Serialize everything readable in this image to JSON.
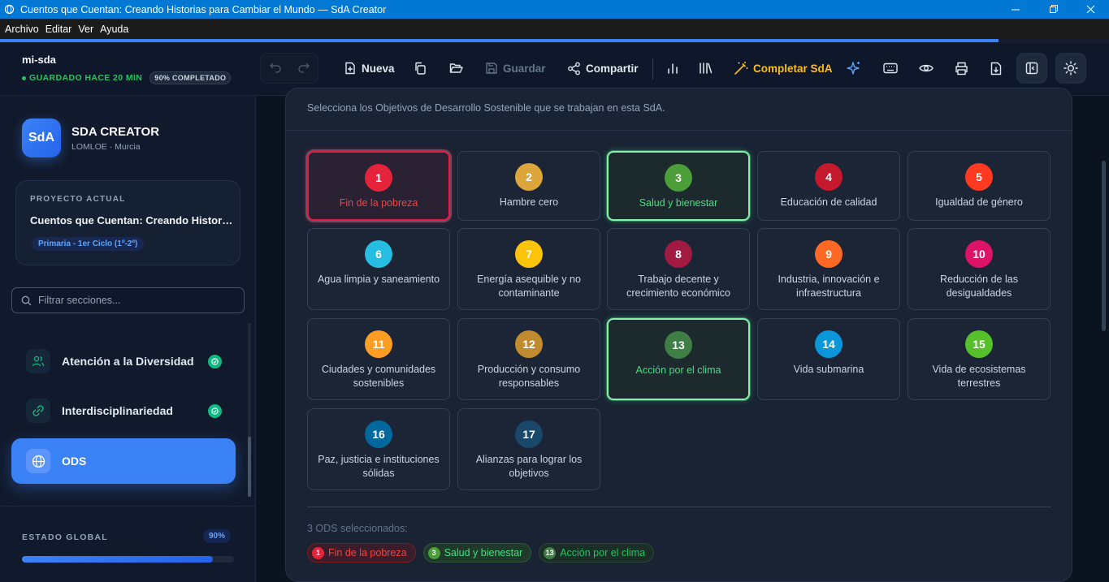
{
  "window": {
    "title": "Cuentos que Cuentan: Creando Historias para Cambiar el Mundo  — SdA Creator"
  },
  "menu": [
    "Archivo",
    "Editar",
    "Ver",
    "Ayuda"
  ],
  "header": {
    "project_slug": "mi-sda",
    "saved_status": "GUARDADO HACE 20 MIN",
    "completion_badge": "90% COMPLETADO",
    "completion_progress": 0.9
  },
  "toolbar": {
    "new_label": "Nueva",
    "save_label": "Guardar",
    "share_label": "Compartir",
    "complete_label": "Completar SdA"
  },
  "sidebar": {
    "brand_title": "SDA CREATOR",
    "brand_subtitle": "LOMLOE · Murcia",
    "logo_text": "SdA",
    "project_card": {
      "label": "PROYECTO ACTUAL",
      "title": "Cuentos que Cuentan: Creando Historias para Cambiar el Mundo",
      "level": "Primaria - 1er Ciclo (1º-2º)"
    },
    "filter_placeholder": "Filtrar secciones...",
    "items": [
      {
        "label": "Atención a la Diversidad",
        "done": true
      },
      {
        "label": "Interdisciplinariedad",
        "done": true
      },
      {
        "label": "ODS",
        "active": true
      }
    ],
    "global_label": "ESTADO GLOBAL",
    "global_percent": "90%",
    "global_progress": 0.9
  },
  "ods_panel": {
    "description": "Selecciona los Objetivos de Desarrollo Sostenible que se trabajan en esta SdA.",
    "goals": [
      {
        "n": "1",
        "name": "Fin de la pobreza",
        "color": "#e5243b",
        "selected": true
      },
      {
        "n": "2",
        "name": "Hambre cero",
        "color": "#dda63a",
        "selected": false
      },
      {
        "n": "3",
        "name": "Salud y bienestar",
        "color": "#4c9f38",
        "selected": true
      },
      {
        "n": "4",
        "name": "Educación de calidad",
        "color": "#c5192d",
        "selected": false
      },
      {
        "n": "5",
        "name": "Igualdad de género",
        "color": "#ff3a21",
        "selected": false
      },
      {
        "n": "6",
        "name": "Agua limpia y saneamiento",
        "color": "#26bde2",
        "selected": false
      },
      {
        "n": "7",
        "name": "Energía asequible y no contaminante",
        "color": "#fcc30b",
        "selected": false
      },
      {
        "n": "8",
        "name": "Trabajo decente y crecimiento económico",
        "color": "#a21942",
        "selected": false
      },
      {
        "n": "9",
        "name": "Industria, innovación e infraestructura",
        "color": "#fd6925",
        "selected": false
      },
      {
        "n": "10",
        "name": "Reducción de las desigualdades",
        "color": "#dd1367",
        "selected": false
      },
      {
        "n": "11",
        "name": "Ciudades y comunidades sostenibles",
        "color": "#fd9d24",
        "selected": false
      },
      {
        "n": "12",
        "name": "Producción y consumo responsables",
        "color": "#bf8b2e",
        "selected": false
      },
      {
        "n": "13",
        "name": "Acción por el clima",
        "color": "#3f7e44",
        "selected": true
      },
      {
        "n": "14",
        "name": "Vida submarina",
        "color": "#0a97d9",
        "selected": false
      },
      {
        "n": "15",
        "name": "Vida de ecosistemas terrestres",
        "color": "#56c02b",
        "selected": false
      },
      {
        "n": "16",
        "name": "Paz, justicia e instituciones sólidas",
        "color": "#00689d",
        "selected": false
      },
      {
        "n": "17",
        "name": "Alianzas para lograr los objetivos",
        "color": "#19486a",
        "selected": false
      }
    ],
    "selected_count_text": "3 ODS seleccionados:",
    "chips": [
      {
        "n": "1",
        "name": "Fin de la pobreza",
        "color": "#e5243b"
      },
      {
        "n": "3",
        "name": "Salud y bienestar",
        "color": "#4c9f38"
      },
      {
        "n": "13",
        "name": "Acción por el clima",
        "color": "#3f7e44"
      }
    ]
  }
}
